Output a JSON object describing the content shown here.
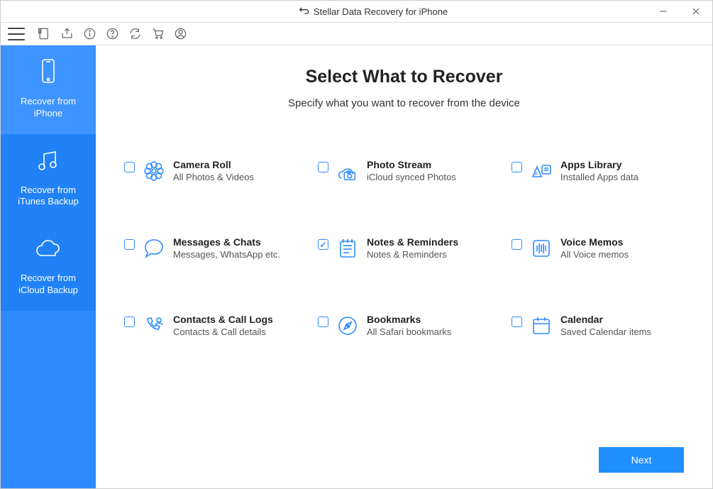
{
  "window": {
    "title": "Stellar Data Recovery for iPhone"
  },
  "toolbarIcons": [
    "menu",
    "save",
    "export",
    "info",
    "help",
    "refresh",
    "cart",
    "profile"
  ],
  "sidebar": {
    "items": [
      {
        "label": "Recover from\niPhone",
        "active": true
      },
      {
        "label": "Recover from\niTunes Backup",
        "active": false
      },
      {
        "label": "Recover from\niCloud Backup",
        "active": false
      }
    ]
  },
  "main": {
    "title": "Select What to Recover",
    "subtitle": "Specify what you want to recover from the device",
    "options": [
      {
        "key": "camera-roll",
        "title": "Camera Roll",
        "subtitle": "All Photos & Videos",
        "checked": false
      },
      {
        "key": "photo-stream",
        "title": "Photo Stream",
        "subtitle": "iCloud synced Photos",
        "checked": false
      },
      {
        "key": "apps-library",
        "title": "Apps Library",
        "subtitle": "Installed Apps data",
        "checked": false
      },
      {
        "key": "messages",
        "title": "Messages & Chats",
        "subtitle": "Messages, WhatsApp etc.",
        "checked": false
      },
      {
        "key": "notes",
        "title": "Notes & Reminders",
        "subtitle": "Notes & Reminders",
        "checked": true
      },
      {
        "key": "voice-memos",
        "title": "Voice Memos",
        "subtitle": "All Voice memos",
        "checked": false
      },
      {
        "key": "contacts",
        "title": "Contacts & Call Logs",
        "subtitle": "Contacts & Call details",
        "checked": false
      },
      {
        "key": "bookmarks",
        "title": "Bookmarks",
        "subtitle": "All Safari bookmarks",
        "checked": false
      },
      {
        "key": "calendar",
        "title": "Calendar",
        "subtitle": "Saved Calendar items",
        "checked": false
      }
    ],
    "nextLabel": "Next"
  }
}
